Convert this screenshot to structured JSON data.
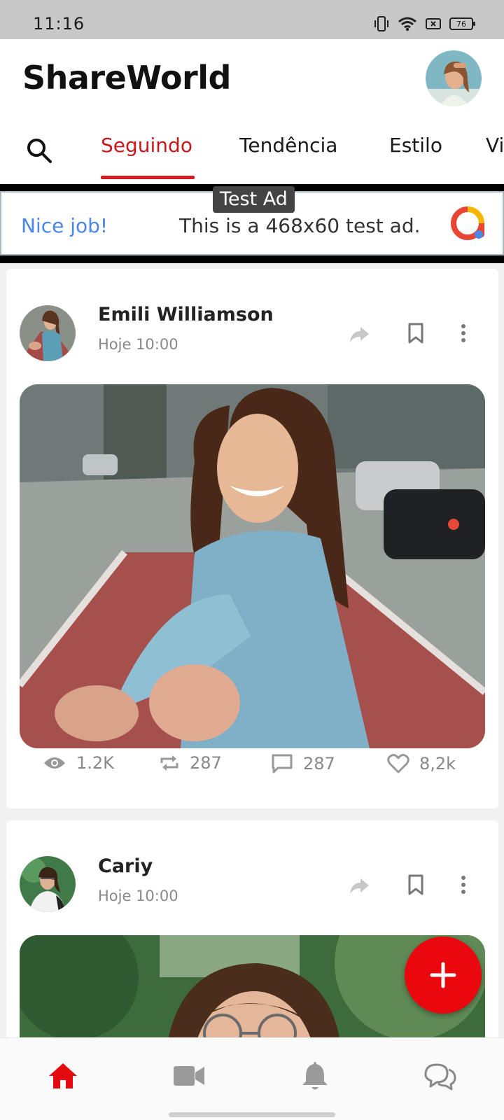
{
  "status_bar": {
    "time": "11:16",
    "battery": "76",
    "icons": [
      "vibrate-icon",
      "wifi-icon",
      "screen-cast-icon",
      "battery-icon"
    ]
  },
  "app": {
    "title": "ShareWorld"
  },
  "tabs": [
    {
      "label": "Seguindo",
      "active": true
    },
    {
      "label": "Tendência",
      "active": false
    },
    {
      "label": "Estilo",
      "active": false
    },
    {
      "label": "Vi",
      "active": false
    }
  ],
  "ad": {
    "label": "Test Ad",
    "headline": "Nice job!",
    "text": "This is a 468x60 test ad."
  },
  "posts": [
    {
      "author": "Emili Williamson",
      "time": "Hoje 10:00",
      "stats": {
        "views": "1.2K",
        "reposts": "287",
        "comments": "287",
        "likes": "8,2k"
      }
    },
    {
      "author": "Cariy",
      "time": "Hoje 10:00"
    }
  ],
  "bottom_nav": [
    "home-icon",
    "video-icon",
    "bell-icon",
    "chat-icon"
  ],
  "colors": {
    "accent": "#d41c22",
    "fab": "#e8080e",
    "ad_blue": "#4a86e8"
  }
}
